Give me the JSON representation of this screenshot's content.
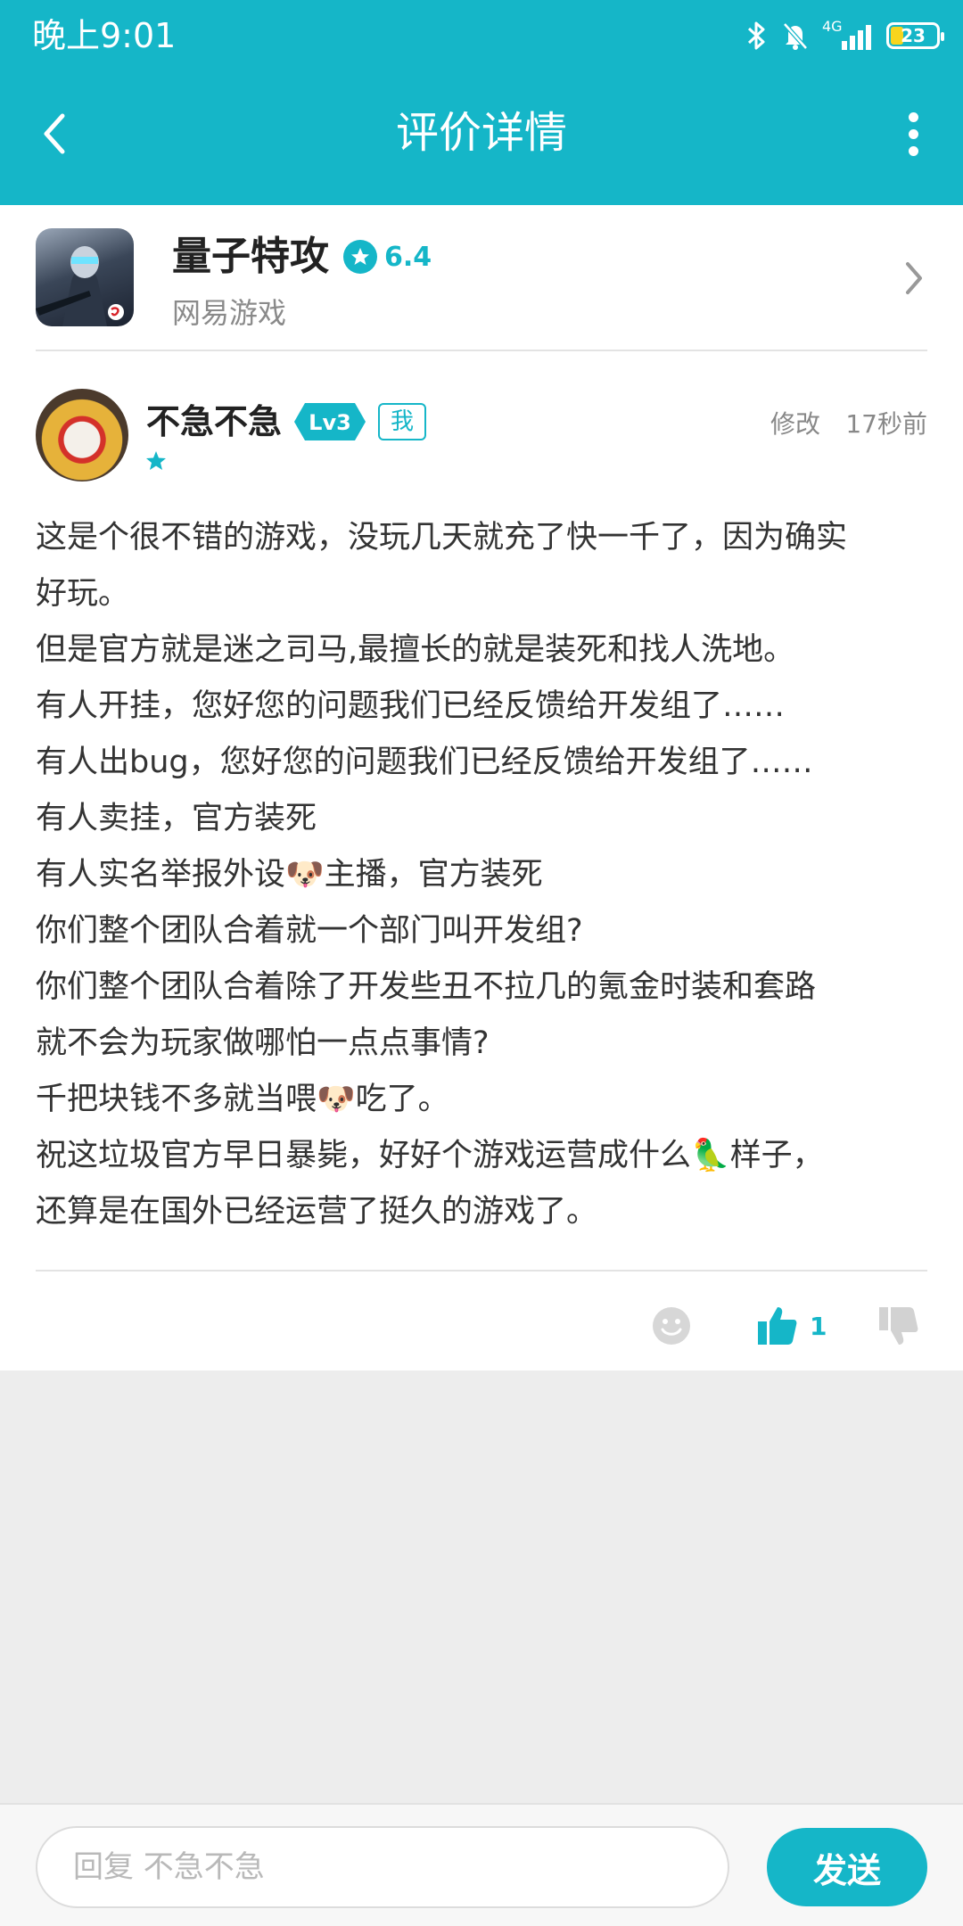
{
  "status_bar": {
    "time": "晚上9:01",
    "network": "4G",
    "battery": "23"
  },
  "nav": {
    "title": "评价详情"
  },
  "game": {
    "name": "量子特攻",
    "rating": "6.4",
    "developer": "网易游戏"
  },
  "review": {
    "user_name": "不急不急",
    "level": "Lv3",
    "me_tag": "我",
    "star_count": 1,
    "edit_label": "修改",
    "time_ago": "17秒前",
    "lines": [
      "这是个很不错的游戏，没玩几天就充了快一千了，因为确实",
      "好玩。",
      "但是官方就是迷之司马,最擅长的就是装死和找人洗地。",
      "有人开挂，您好您的问题我们已经反馈给开发组了……",
      "有人出bug，您好您的问题我们已经反馈给开发组了……",
      "有人卖挂，官方装死",
      "有人实名举报外设🐶主播，官方装死",
      "你们整个团队合着就一个部门叫开发组?",
      "你们整个团队合着除了开发些丑不拉几的氪金时装和套路",
      "就不会为玩家做哪怕一点点事情?",
      "千把块钱不多就当喂🐶吃了。",
      "祝这垃圾官方早日暴毙，好好个游戏运营成什么🦜样子，",
      "还算是在国外已经运营了挺久的游戏了。"
    ],
    "like_count": "1"
  },
  "reply": {
    "placeholder": "回复 不急不急",
    "send_label": "发送"
  },
  "colors": {
    "accent": "#15b6c8",
    "background": "#ededed"
  },
  "icons": [
    "back-arrow-icon",
    "more-vertical-icon",
    "bluetooth-icon",
    "bell-off-icon",
    "signal-icon",
    "battery-icon",
    "star-icon",
    "chevron-right-icon",
    "emoji-icon",
    "thumb-up-icon",
    "thumb-down-icon"
  ]
}
